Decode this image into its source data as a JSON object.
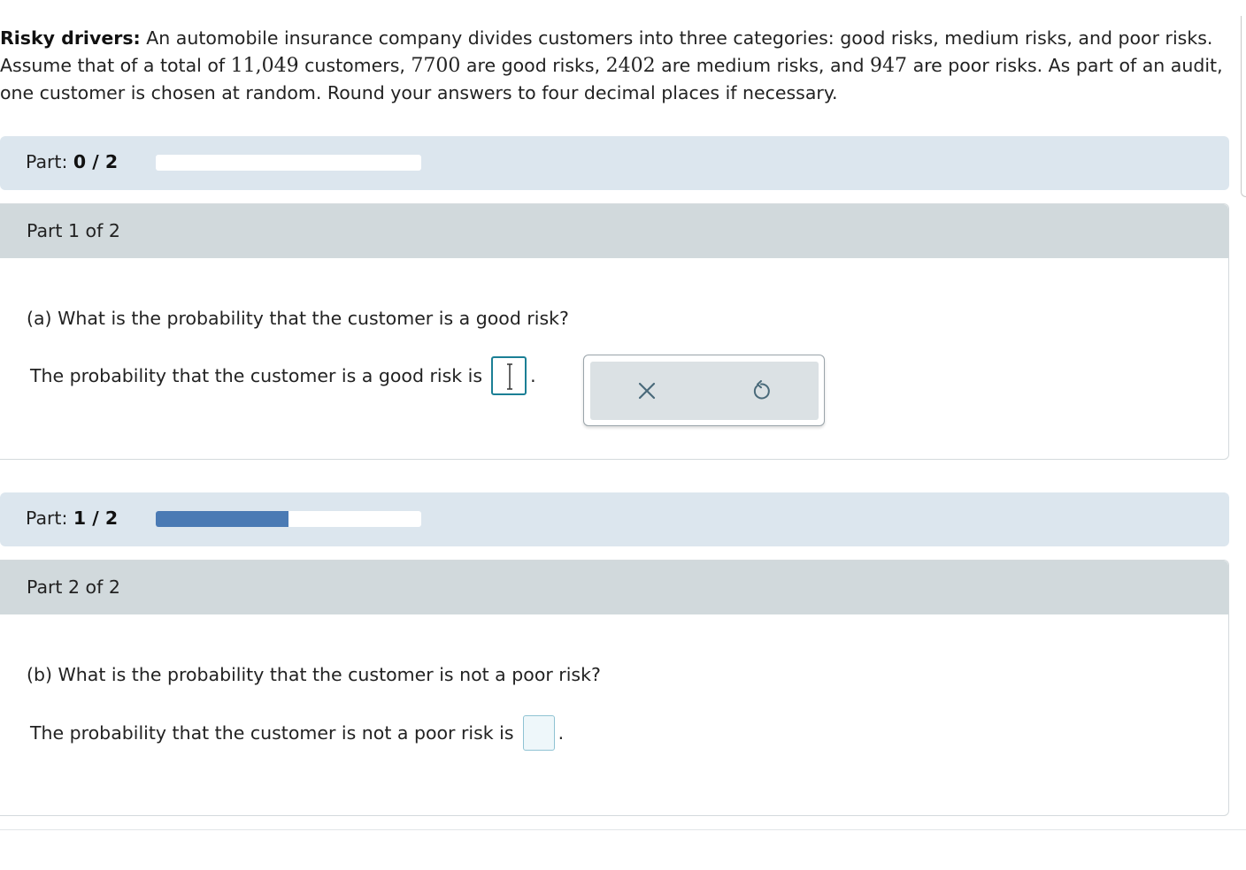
{
  "problem": {
    "title": "Risky drivers:",
    "text_1": " An automobile insurance company divides customers into three categories: good risks, medium risks, and poor risks. Assume that of a total of ",
    "total": "11,049",
    "text_2": " customers, ",
    "good": "7700",
    "text_3": " are good risks, ",
    "medium": "2402",
    "text_4": " are medium risks, and ",
    "poor": "947",
    "text_5": " are poor risks. As part of an audit, one customer is chosen at random. Round your answers to four decimal places if necessary."
  },
  "progress_1": {
    "label": "Part: ",
    "value": "0 / 2",
    "fraction": 0
  },
  "part_1": {
    "header": "Part 1 of 2",
    "question": "(a) What is the probability that the customer is a good risk?",
    "answer_prefix": "The probability that the customer is a good risk is",
    "period": "."
  },
  "tools": {
    "clear_icon": "close-icon",
    "undo_icon": "undo-icon"
  },
  "progress_2": {
    "label": "Part: ",
    "value": "1 / 2",
    "fraction": 0.5
  },
  "part_2": {
    "header": "Part 2 of 2",
    "question": "(b) What is the probability that the customer is not a poor risk?",
    "answer_prefix": "The probability that the customer is not a poor risk is",
    "period": "."
  },
  "colors": {
    "progress_fill": "#4a7ab4",
    "active_border": "#1b7f95"
  }
}
